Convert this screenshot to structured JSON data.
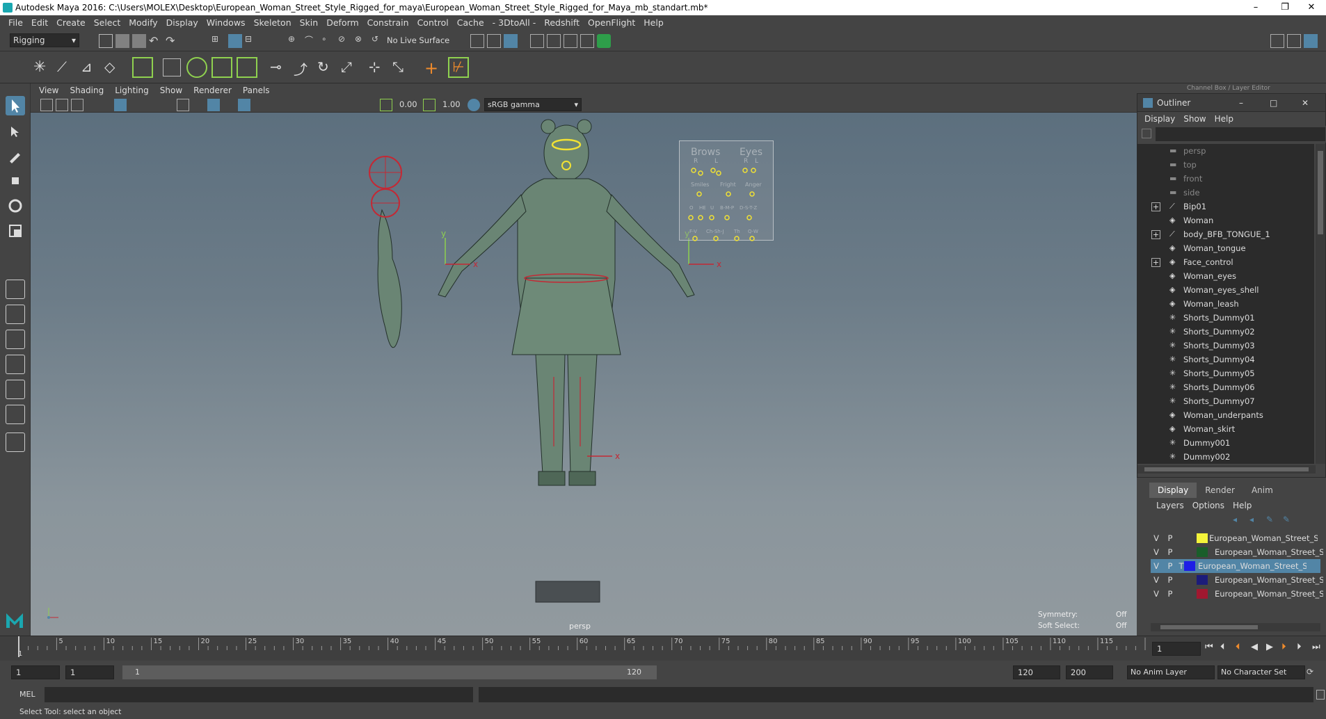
{
  "window": {
    "title": "Autodesk Maya 2016: C:\\Users\\MOLEX\\Desktop\\European_Woman_Street_Style_Rigged_for_maya\\European_Woman_Street_Style_Rigged_for_Maya_mb_standart.mb*",
    "minimize": "–",
    "restore": "❐",
    "close": "✕"
  },
  "menubar": [
    "File",
    "Edit",
    "Create",
    "Select",
    "Modify",
    "Display",
    "Windows",
    "Skeleton",
    "Skin",
    "Deform",
    "Constrain",
    "Control",
    "Cache",
    "- 3DtoAll -",
    "Redshift",
    "OpenFlight",
    "Help"
  ],
  "shelf": {
    "menuset": "Rigging",
    "live_surface": "No Live Surface"
  },
  "viewport": {
    "menu": [
      "View",
      "Shading",
      "Lighting",
      "Show",
      "Renderer",
      "Panels"
    ],
    "near_value": "0.00",
    "far_value": "1.00",
    "color_space": "sRGB gamma",
    "camera_label": "persp",
    "symmetry_label": "Symmetry:",
    "symmetry_value": "Off",
    "soft_select_label": "Soft Select:",
    "soft_select_value": "Off",
    "face_panel": {
      "brows": "Brows",
      "eyes": "Eyes",
      "r1": "R",
      "l1": "L",
      "r2": "R",
      "l2": "L",
      "smiles": "Smiles",
      "fright": "Fright",
      "anger": "Anger",
      "b0": "O",
      "b1": "HE",
      "b2": "U",
      "b3": "B-M-P",
      "b4": "D-S-T-Z",
      "c0": "F-V",
      "c1": "Ch-Sh-J",
      "c2": "Th",
      "c3": "Q-W"
    }
  },
  "channel_box_header": "Channel Box / Layer Editor",
  "outliner": {
    "title": "Outliner",
    "menu": [
      "Display",
      "Show",
      "Help"
    ],
    "items": [
      {
        "label": "persp",
        "icon": "camera",
        "dim": true
      },
      {
        "label": "top",
        "icon": "camera",
        "dim": true
      },
      {
        "label": "front",
        "icon": "camera",
        "dim": true
      },
      {
        "label": "side",
        "icon": "camera",
        "dim": true
      },
      {
        "label": "Bip01",
        "icon": "joint",
        "expand": true
      },
      {
        "label": "Woman",
        "icon": "mesh"
      },
      {
        "label": "body_BFB_TONGUE_1",
        "icon": "joint",
        "expand": true
      },
      {
        "label": "Woman_tongue",
        "icon": "mesh"
      },
      {
        "label": "Face_control",
        "icon": "mesh",
        "expand": true
      },
      {
        "label": "Woman_eyes",
        "icon": "mesh"
      },
      {
        "label": "Woman_eyes_shell",
        "icon": "mesh"
      },
      {
        "label": "Woman_leash",
        "icon": "mesh"
      },
      {
        "label": "Shorts_Dummy01",
        "icon": "locator"
      },
      {
        "label": "Shorts_Dummy02",
        "icon": "locator"
      },
      {
        "label": "Shorts_Dummy03",
        "icon": "locator"
      },
      {
        "label": "Shorts_Dummy04",
        "icon": "locator"
      },
      {
        "label": "Shorts_Dummy05",
        "icon": "locator"
      },
      {
        "label": "Shorts_Dummy06",
        "icon": "locator"
      },
      {
        "label": "Shorts_Dummy07",
        "icon": "locator"
      },
      {
        "label": "Woman_underpants",
        "icon": "mesh"
      },
      {
        "label": "Woman_skirt",
        "icon": "mesh"
      },
      {
        "label": "Dummy001",
        "icon": "locator"
      },
      {
        "label": "Dummy002",
        "icon": "locator"
      }
    ]
  },
  "layers": {
    "tabs": [
      "Display",
      "Render",
      "Anim"
    ],
    "menu": [
      "Layers",
      "Options",
      "Help"
    ],
    "rows": [
      {
        "v": "V",
        "p": "P",
        "color": "#f4f43a",
        "name": "European_Woman_Street_Style",
        "selected": false
      },
      {
        "v": "V",
        "p": "P",
        "color": "#1a5e2a",
        "name": "European_Woman_Street_Sty",
        "selected": false
      },
      {
        "v": "V",
        "p": "P",
        "t": "T",
        "color": "#1e1ee6",
        "name": "European_Woman_Street_Style_Rig",
        "selected": true
      },
      {
        "v": "V",
        "p": "P",
        "color": "#1c1c7a",
        "name": "European_Woman_Street_Sty",
        "selected": false
      },
      {
        "v": "V",
        "p": "P",
        "color": "#a01830",
        "name": "European_Woman_Street_Sty",
        "selected": false
      }
    ]
  },
  "timeline": {
    "ticks": [
      "5",
      "10",
      "15",
      "20",
      "25",
      "30",
      "35",
      "40",
      "45",
      "50",
      "55",
      "60",
      "65",
      "70",
      "75",
      "80",
      "85",
      "90",
      "95",
      "100",
      "105",
      "110",
      "115",
      "120"
    ],
    "first_tick": "1",
    "current_frame": "1"
  },
  "range": {
    "start": "1",
    "start_inner": "1",
    "slider_start": "1",
    "slider_end": "120",
    "end_inner": "120",
    "end": "200",
    "anim_layer": "No Anim Layer",
    "character_set": "No Character Set"
  },
  "command_line": {
    "language": "MEL"
  },
  "status": {
    "help": "Select Tool: select an object"
  },
  "colors": {
    "accent": "#5285a6",
    "selected_layer": "#5285a6"
  }
}
